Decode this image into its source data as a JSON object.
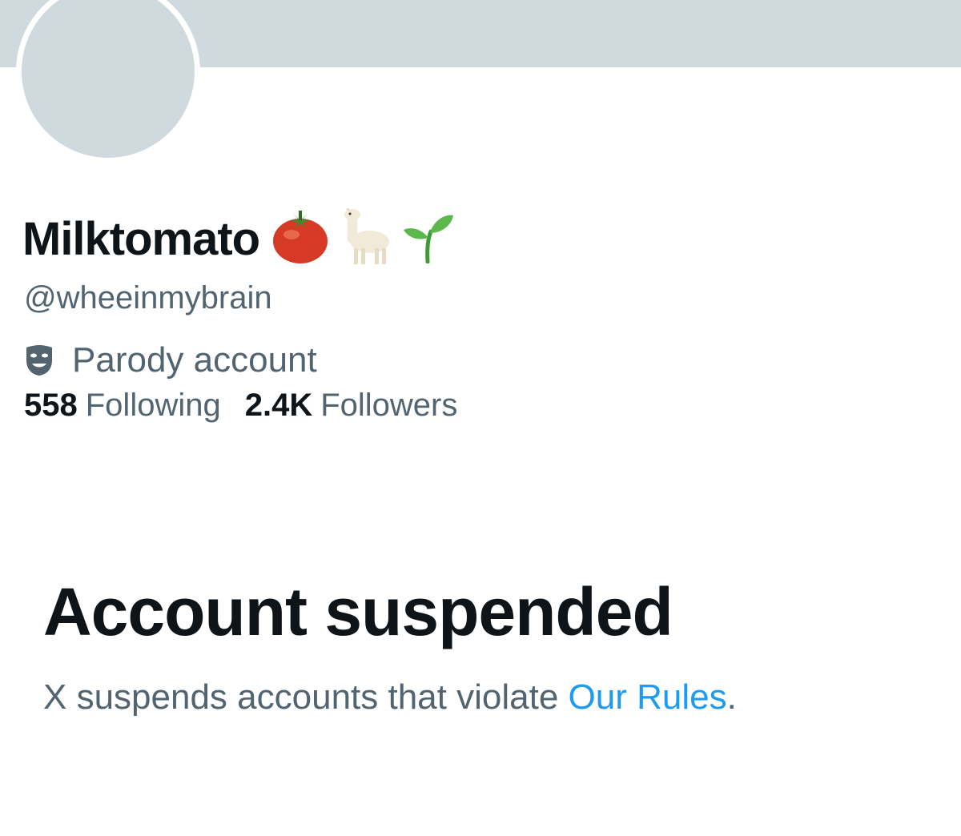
{
  "profile": {
    "display_name": "Milktomato",
    "name_emojis": [
      "tomato-icon",
      "llama-icon",
      "seedling-icon"
    ],
    "handle": "@wheeinmybrain",
    "label_icon": "theater-masks-icon",
    "label_text": "Parody account",
    "following_count": "558",
    "following_label": "Following",
    "followers_count": "2.4K",
    "followers_label": "Followers"
  },
  "suspension": {
    "title": "Account suspended",
    "message_prefix": "X suspends accounts that violate ",
    "link_text": "Our Rules",
    "message_suffix": "."
  },
  "colors": {
    "banner": "#cfd9de",
    "avatar_placeholder": "#cfd9de",
    "primary_text": "#0f1419",
    "secondary_text": "#536471",
    "link": "#1d9bf0"
  }
}
